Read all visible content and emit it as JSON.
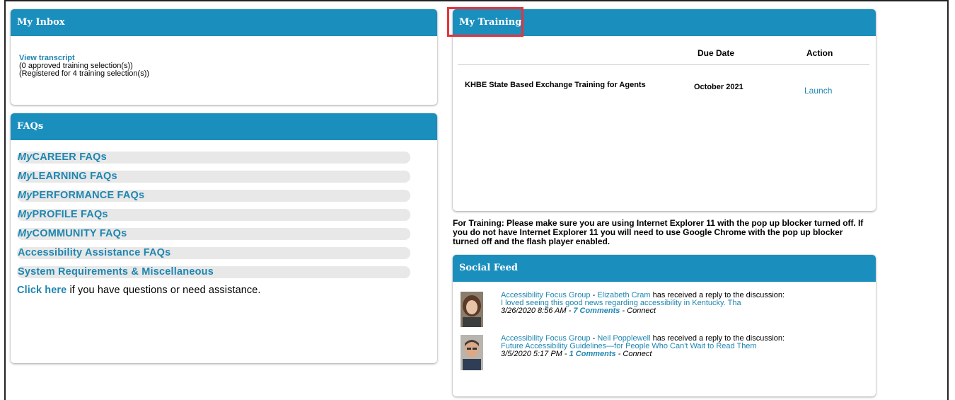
{
  "inbox": {
    "title": "My Inbox",
    "link": "View transcript",
    "line1": "(0 approved training selection(s))",
    "line2": "(Registered for 4 training selection(s))"
  },
  "faqs": {
    "title": "FAQs",
    "items": [
      {
        "prefix": "My",
        "label": "CAREER FAQs"
      },
      {
        "prefix": "My",
        "label": "LEARNING FAQs"
      },
      {
        "prefix": "My",
        "label": "PERFORMANCE FAQs"
      },
      {
        "prefix": "My",
        "label": "PROFILE FAQs"
      },
      {
        "prefix": "My",
        "label": "COMMUNITY FAQs"
      },
      {
        "prefix": "",
        "label": "Accessibility Assistance FAQs"
      },
      {
        "prefix": "",
        "label": "System Requirements & Miscellaneous"
      }
    ],
    "note_link": "Click here",
    "note_text": " if you have questions or need assistance."
  },
  "training": {
    "title": "My Training",
    "col_due": "Due Date",
    "col_action": "Action",
    "row": {
      "name": "KHBE State Based Exchange Training for Agents",
      "due": "October 2021",
      "action": "Launch"
    }
  },
  "note": "For Training: Please make sure you are using Internet Explorer 11 with the pop up blocker turned off. If you do not have Internet Explorer 11 you will need to use Google Chrome with the pop up blocker turned off and the flash player enabled.",
  "social": {
    "title": "Social Feed",
    "items": [
      {
        "group": "Accessibility Focus Group",
        "sep": " - ",
        "person": "Elizabeth Cram",
        "action": " has received a reply to the discussion:",
        "topic": "I loved seeing this good news regarding accessibility in Kentucky. Tha",
        "date": "3/26/2020 8:56 AM - ",
        "comments": "7 Comments",
        "source": " - Connect"
      },
      {
        "group": "Accessibility Focus Group",
        "sep": " - ",
        "person": "Neil Popplewell",
        "action": " has received a reply to the discussion:",
        "topic": "Future Accessibility Guidelines—for People Who Can't Wait to Read Them",
        "date": "3/5/2020 5:17 PM - ",
        "comments": "1 Comments",
        "source": " - Connect"
      }
    ]
  },
  "colors": {
    "header": "#1a8fbd",
    "link": "#1f86b0",
    "highlight": "#e8323a"
  }
}
